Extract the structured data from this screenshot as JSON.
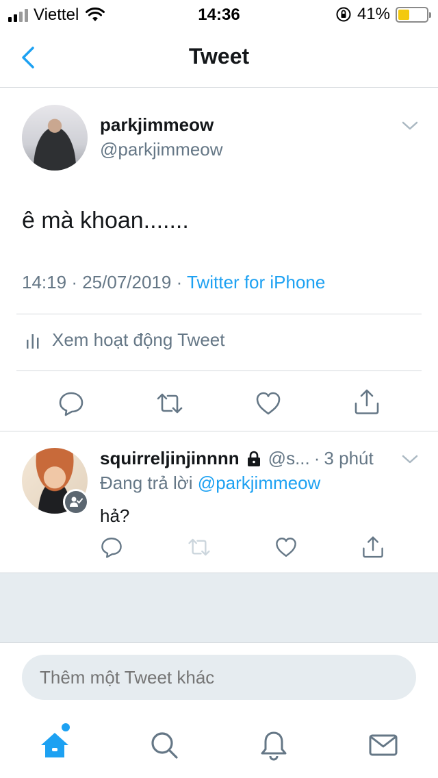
{
  "status_bar": {
    "carrier": "Viettel",
    "time": "14:36",
    "battery_percent": "41%",
    "battery_level": 0.41
  },
  "nav": {
    "title": "Tweet"
  },
  "main_tweet": {
    "display_name": "parkjimmeow",
    "handle": "@parkjimmeow",
    "text": "ê mà khoan.......",
    "time": "14:19",
    "separator": "·",
    "date": "25/07/2019",
    "source": "Twitter for iPhone",
    "activity_label": "Xem hoạt động Tweet"
  },
  "reply": {
    "display_name": "squirreljinjinnnn",
    "handle": "@s...",
    "dot": "·",
    "ago": "3 phút",
    "replying_to_prefix": "Đang trả lời",
    "replying_to_mention": "@parkjimmeow",
    "text": "hả?"
  },
  "compose": {
    "placeholder": "Thêm một Tweet khác"
  },
  "colors": {
    "accent": "#1da1f2",
    "muted": "#657786",
    "divider": "#d4d8dc",
    "filler": "#e6ecf0"
  },
  "icons": {
    "back": "chevron-left-icon",
    "more": "chevron-down-icon",
    "reply": "reply-icon",
    "retweet": "retweet-icon",
    "like": "heart-icon",
    "share": "share-icon",
    "activity": "bar-chart-icon",
    "lock": "lock-icon",
    "home": "home-icon",
    "search": "search-icon",
    "notifications": "bell-icon",
    "messages": "mail-icon"
  }
}
